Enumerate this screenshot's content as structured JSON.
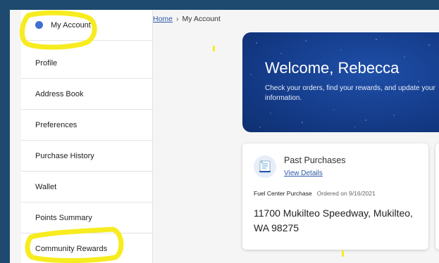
{
  "colors": {
    "outer_background": "#1d4a6e",
    "accent_blue": "#3f6fd1",
    "link_blue": "#2b5aa8",
    "banner_blue": "#143b88",
    "highlight_yellow": "#f7ec1f"
  },
  "sidebar": {
    "items": [
      {
        "label": "My Account",
        "active": true
      },
      {
        "label": "Profile"
      },
      {
        "label": "Address Book"
      },
      {
        "label": "Preferences"
      },
      {
        "label": "Purchase History"
      },
      {
        "label": "Wallet"
      },
      {
        "label": "Points Summary"
      },
      {
        "label": "Community Rewards"
      }
    ]
  },
  "breadcrumb": {
    "home": "Home",
    "separator": "›",
    "current": "My Account"
  },
  "welcome": {
    "title": "Welcome, Rebecca",
    "subtitle": "Check your orders, find your rewards, and update your information."
  },
  "past_purchases": {
    "icon": "receipt-icon",
    "title": "Past Purchases",
    "link": "View Details",
    "purchase_type": "Fuel Center Purchase",
    "ordered": "Ordered on 9/16/2021",
    "address": "11700 Mukilteo Speedway, Mukilteo, WA 98275"
  }
}
